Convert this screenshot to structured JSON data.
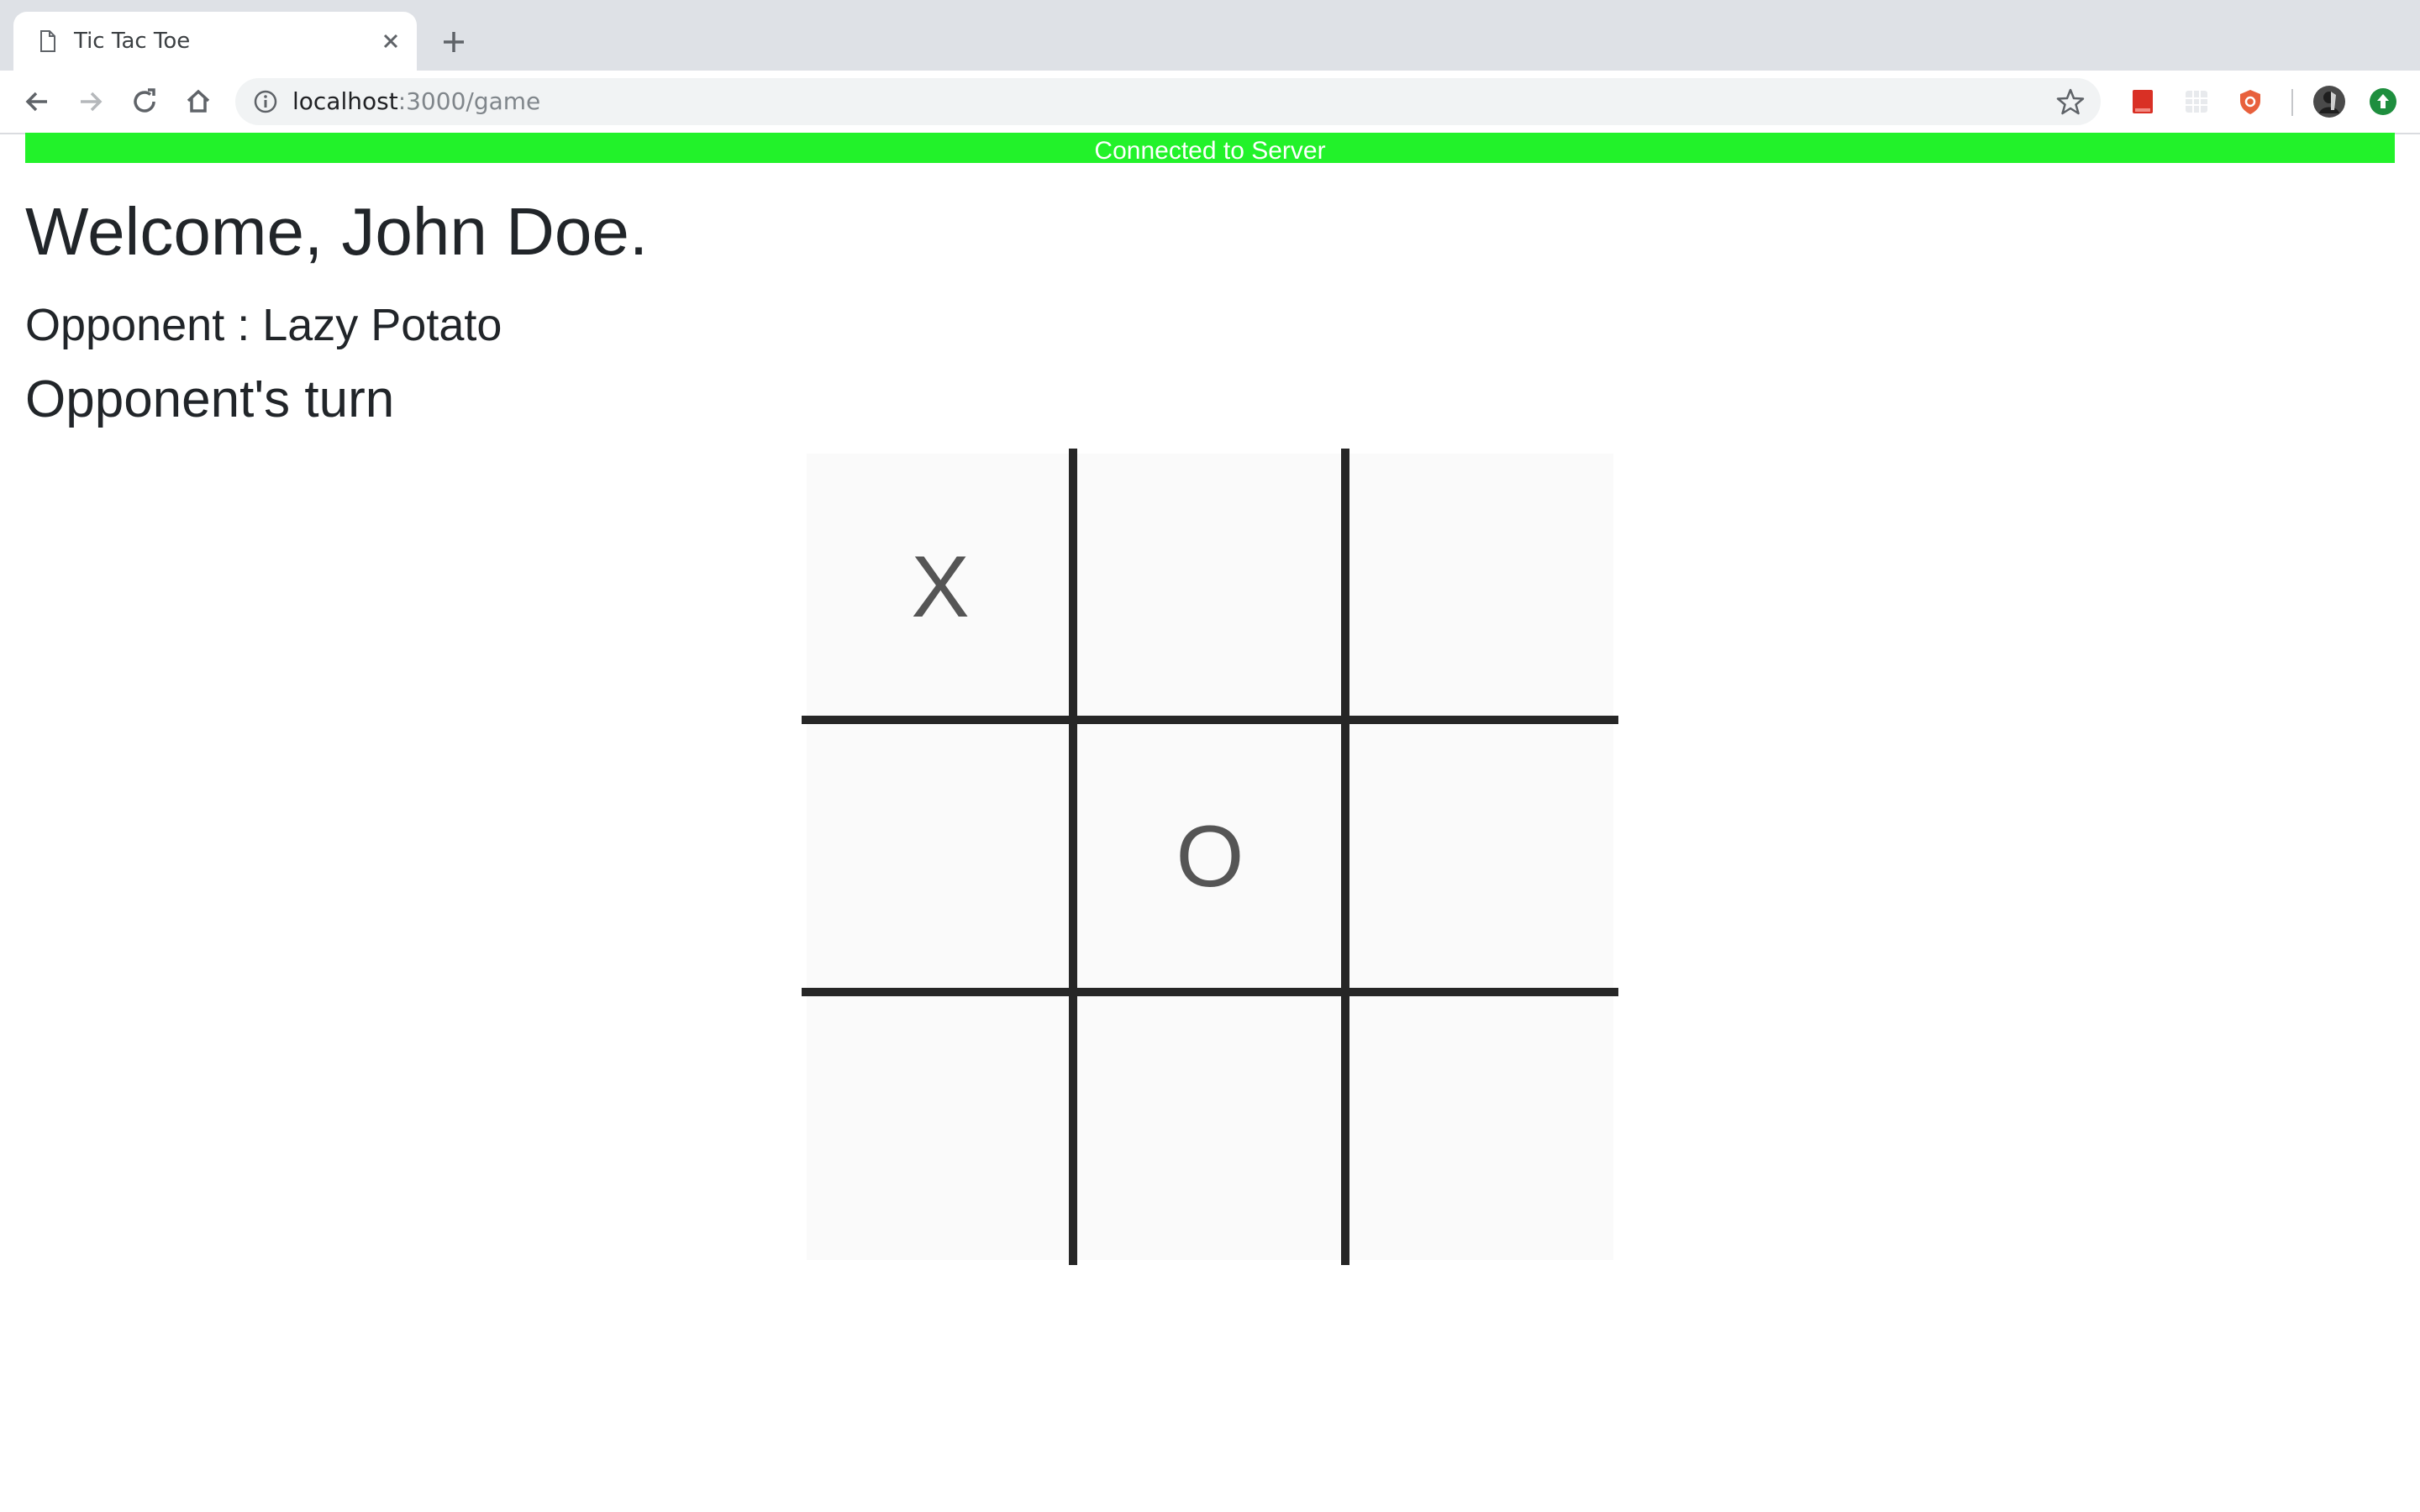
{
  "browser": {
    "tab_title": "Tic Tac Toe",
    "url_host": "localhost",
    "url_rest": ":3000/game"
  },
  "page": {
    "status": "Connected to Server",
    "status_color": "#22f22a",
    "welcome": "Welcome, John Doe.",
    "opponent": "Opponent : Lazy Potato",
    "turn": "Opponent's turn"
  },
  "board": {
    "cells": [
      "X",
      "",
      "",
      "",
      "O",
      "",
      "",
      "",
      ""
    ]
  }
}
